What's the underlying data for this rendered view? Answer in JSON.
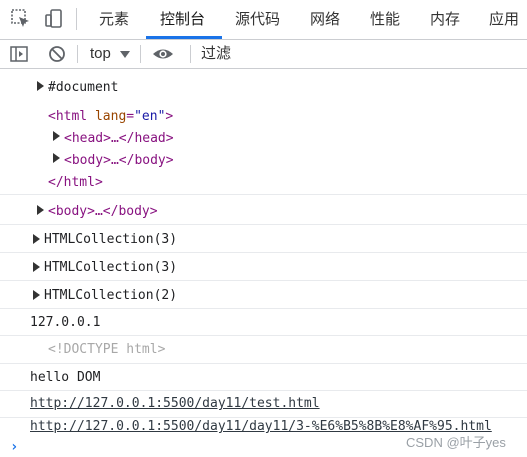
{
  "tabs": [
    {
      "label": "元素"
    },
    {
      "label": "控制台"
    },
    {
      "label": "源代码"
    },
    {
      "label": "网络"
    },
    {
      "label": "性能"
    },
    {
      "label": "内存"
    },
    {
      "label": "应用"
    }
  ],
  "toolbar": {
    "context": "top",
    "filter_placeholder": "过滤"
  },
  "console": {
    "document_label": "#document",
    "html_open_tag": "<html",
    "html_attr_name": "lang",
    "html_attr_value": "\"en\"",
    "html_open_close": ">",
    "head_collapsed": "<head>…</head>",
    "body_collapsed": "<body>…</body>",
    "html_close": "</html>",
    "body_element": "<body>…</body>",
    "collection1": "HTMLCollection(3)",
    "collection2": "HTMLCollection(3)",
    "collection3": "HTMLCollection(2)",
    "host": "127.0.0.1",
    "doctype": "<!DOCTYPE html>",
    "text": "hello DOM",
    "url1": "http://127.0.0.1:5500/day11/test.html",
    "url2": "http://127.0.0.1:5500/day11/day11/3-%E6%B5%8B%E8%AF%95.html",
    "prompt": "›"
  },
  "watermark": "CSDN @叶子yes",
  "colors": {
    "accent": "#1a73e8",
    "tag": "#881280",
    "attr_name": "#994500",
    "attr_value": "#1a1aa6"
  }
}
